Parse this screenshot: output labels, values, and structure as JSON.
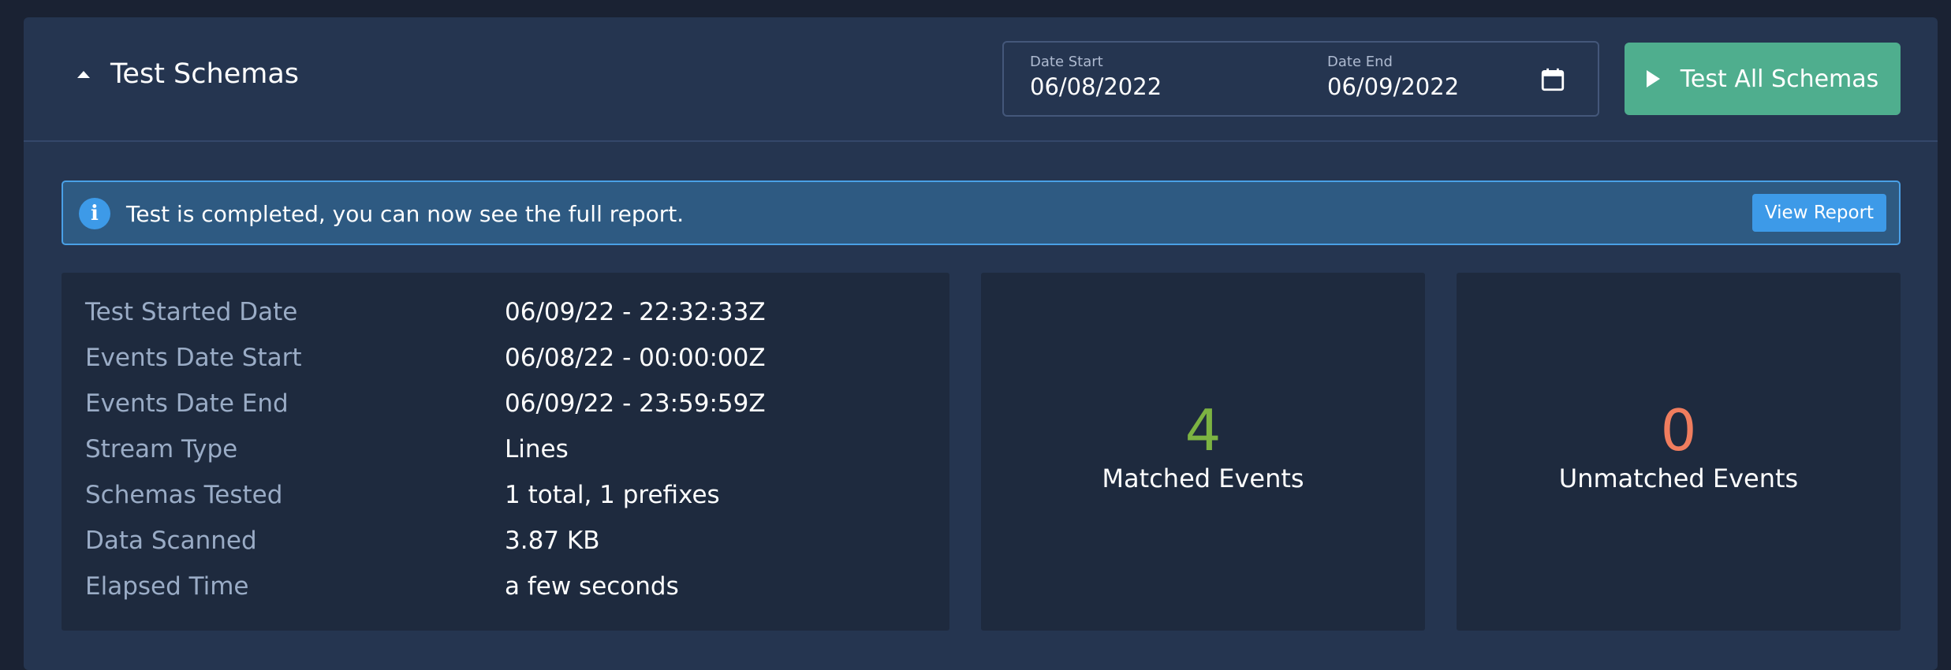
{
  "header": {
    "title": "Test Schemas",
    "date_start_label": "Date Start",
    "date_start_value": "06/08/2022",
    "date_end_label": "Date End",
    "date_end_value": "06/09/2022",
    "test_all_label": "Test All Schemas",
    "icons": {
      "collapse": "caret-up-icon",
      "calendar": "calendar-icon",
      "play": "play-icon"
    },
    "colors": {
      "test_button": "#4fae8e"
    }
  },
  "alert": {
    "icon": "info-icon",
    "message": "Test is completed, you can now see the full report.",
    "action_label": "View Report",
    "colors": {
      "background": "#2e5a82",
      "border": "#4aa0e6",
      "button": "#3d9ae8"
    }
  },
  "details": {
    "rows": [
      {
        "label": "Test Started Date",
        "value": "06/09/22 - 22:32:33Z"
      },
      {
        "label": "Events Date Start",
        "value": "06/08/22 - 00:00:00Z"
      },
      {
        "label": "Events Date End",
        "value": "06/09/22 - 23:59:59Z"
      },
      {
        "label": "Stream Type",
        "value": "Lines"
      },
      {
        "label": "Schemas Tested",
        "value": "1 total, 1 prefixes"
      },
      {
        "label": "Data Scanned",
        "value": "3.87 KB"
      },
      {
        "label": "Elapsed Time",
        "value": "a few seconds"
      }
    ]
  },
  "stats": {
    "matched": {
      "value": "4",
      "label": "Matched Events",
      "color": "#7cb342"
    },
    "unmatched": {
      "value": "0",
      "label": "Unmatched Events",
      "color": "#f07d5e"
    }
  }
}
